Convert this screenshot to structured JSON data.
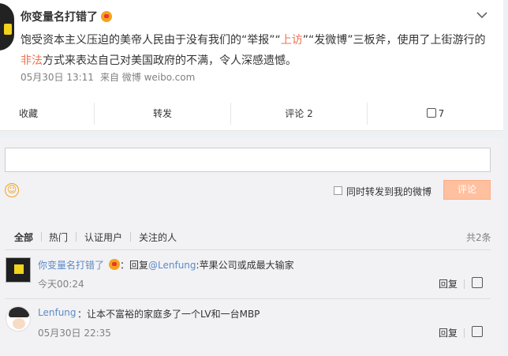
{
  "post": {
    "author": "你变量名打错了",
    "text_parts": [
      "饱受资本主义压迫的美帝人民由于没有我们的“举报”“",
      "上访",
      "”“发微博”三板斧，使用了上街游行的",
      "非法",
      "方式来表达自己对美国政府的不满，令人深感遗憾。"
    ],
    "date": "05月30日 13:11",
    "source": "来自 微博 weibo.com"
  },
  "actions": {
    "favorite": "收藏",
    "repost": "转发",
    "comment": "评论 2",
    "likes": "7"
  },
  "composer": {
    "repost_label": "同时转发到我的微博",
    "submit": "评论"
  },
  "tabs": {
    "items": [
      "全部",
      "热门",
      "认证用户",
      "关注的人"
    ],
    "count": "共2条"
  },
  "comments": [
    {
      "name": "你变量名打错了",
      "prefix": "：回复",
      "mention": "@Lenfung",
      "text": ":苹果公司或成最大输家",
      "time": "今天00:24",
      "reply": "回复"
    },
    {
      "name": "Lenfung",
      "prefix": "：",
      "mention": "",
      "text": "让本不富裕的家庭多了一个LV和一台MBP",
      "time": "05月30日 22:35",
      "reply": "回复"
    }
  ],
  "colors": {
    "link": "#5d8bc4",
    "accent": "#eb7350",
    "submit_bg": "#ffc09f"
  }
}
